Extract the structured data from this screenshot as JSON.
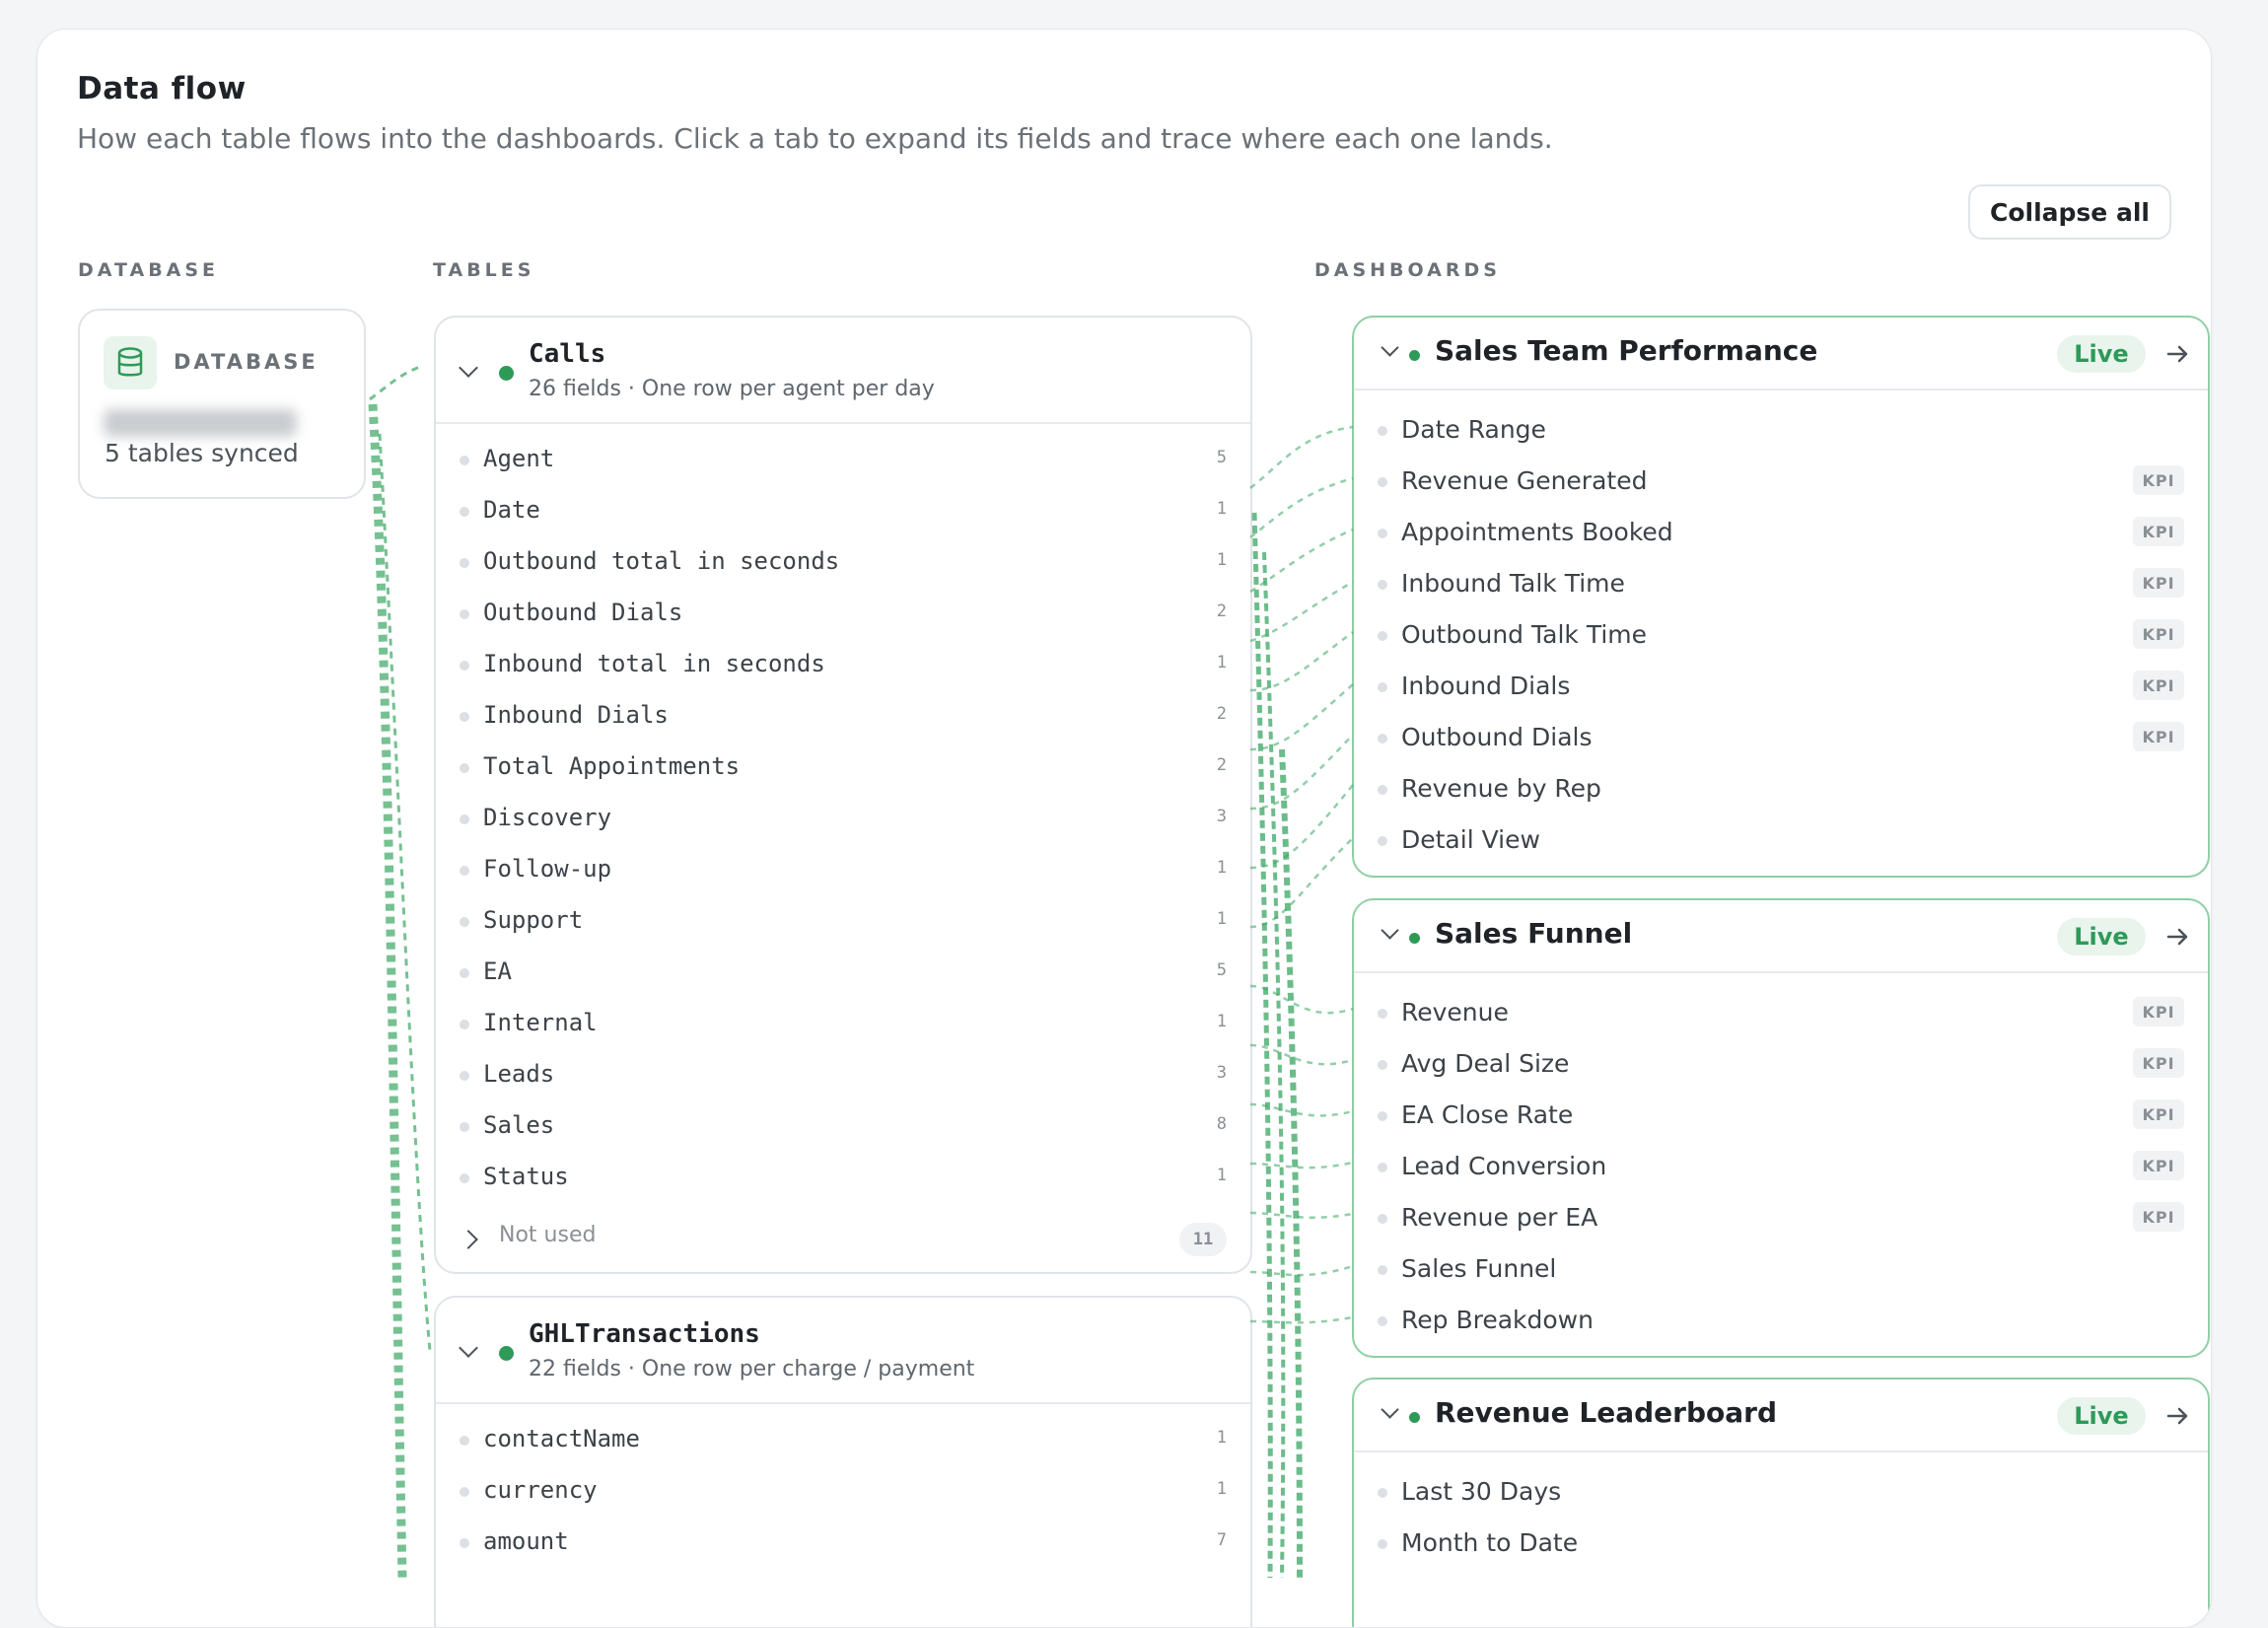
{
  "header": {
    "title": "Data flow",
    "subtitle": "How each table flows into the dashboards. Click a tab to expand its fields and trace where each one lands.",
    "collapse_label": "Collapse all"
  },
  "columns": {
    "database": "DATABASE",
    "tables": "TABLES",
    "dashboards": "DASHBOARDS"
  },
  "database": {
    "label": "DATABASE",
    "sync_status": "5 tables synced",
    "icon": "database-icon"
  },
  "tables": [
    {
      "name": "Calls",
      "meta": "26 fields · One row per agent per day",
      "fields": [
        {
          "name": "Agent",
          "count": "5"
        },
        {
          "name": "Date",
          "count": "1"
        },
        {
          "name": "Outbound total in seconds",
          "count": "1"
        },
        {
          "name": "Outbound Dials",
          "count": "2"
        },
        {
          "name": "Inbound total in seconds",
          "count": "1"
        },
        {
          "name": "Inbound Dials",
          "count": "2"
        },
        {
          "name": "Total Appointments",
          "count": "2"
        },
        {
          "name": "Discovery",
          "count": "3"
        },
        {
          "name": "Follow-up",
          "count": "1"
        },
        {
          "name": "Support",
          "count": "1"
        },
        {
          "name": "EA",
          "count": "5"
        },
        {
          "name": "Internal",
          "count": "1"
        },
        {
          "name": "Leads",
          "count": "3"
        },
        {
          "name": "Sales",
          "count": "8"
        },
        {
          "name": "Status",
          "count": "1"
        }
      ],
      "not_used_label": "Not used",
      "not_used_count": "11"
    },
    {
      "name": "GHLTransactions",
      "meta": "22 fields · One row per charge / payment",
      "fields": [
        {
          "name": "contactName",
          "count": "1"
        },
        {
          "name": "currency",
          "count": "1"
        },
        {
          "name": "amount",
          "count": "7"
        }
      ]
    }
  ],
  "dashboards": [
    {
      "name": "Sales Team Performance",
      "status": "Live",
      "items": [
        {
          "label": "Date Range",
          "badge": ""
        },
        {
          "label": "Revenue Generated",
          "badge": "KPI"
        },
        {
          "label": "Appointments Booked",
          "badge": "KPI"
        },
        {
          "label": "Inbound Talk Time",
          "badge": "KPI"
        },
        {
          "label": "Outbound Talk Time",
          "badge": "KPI"
        },
        {
          "label": "Inbound Dials",
          "badge": "KPI"
        },
        {
          "label": "Outbound Dials",
          "badge": "KPI"
        },
        {
          "label": "Revenue by Rep",
          "badge": ""
        },
        {
          "label": "Detail View",
          "badge": ""
        }
      ]
    },
    {
      "name": "Sales Funnel",
      "status": "Live",
      "items": [
        {
          "label": "Revenue",
          "badge": "KPI"
        },
        {
          "label": "Avg Deal Size",
          "badge": "KPI"
        },
        {
          "label": "EA Close Rate",
          "badge": "KPI"
        },
        {
          "label": "Lead Conversion",
          "badge": "KPI"
        },
        {
          "label": "Revenue per EA",
          "badge": "KPI"
        },
        {
          "label": "Sales Funnel",
          "badge": ""
        },
        {
          "label": "Rep Breakdown",
          "badge": ""
        }
      ]
    },
    {
      "name": "Revenue Leaderboard",
      "status": "Live",
      "items": [
        {
          "label": "Last 30 Days",
          "badge": ""
        },
        {
          "label": "Month to Date",
          "badge": ""
        }
      ]
    }
  ],
  "colors": {
    "accent": "#2e9a58",
    "flow_line": "#3aa663",
    "dashboard_border": "#8fcfa4"
  }
}
